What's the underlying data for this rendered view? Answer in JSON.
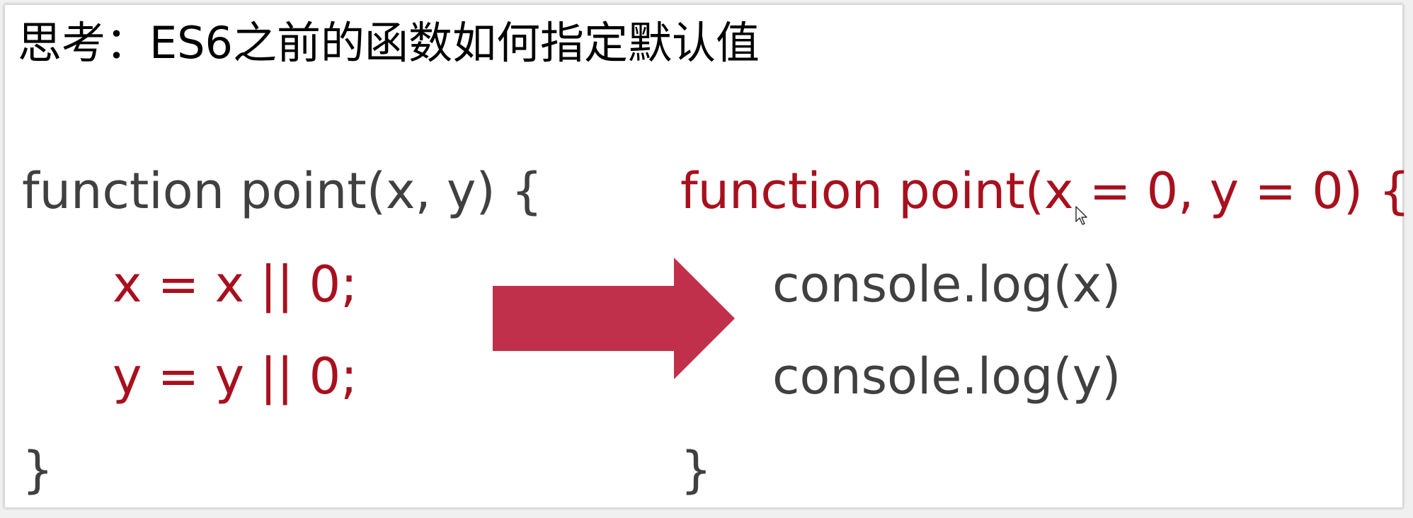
{
  "colors": {
    "text": "#404040",
    "accent": "#a8101e",
    "arrow": "#c0304a"
  },
  "slide": {
    "title": "思考：ES6之前的函数如何指定默认值",
    "left_code": [
      "function point(x, y) {",
      "x = x || 0;",
      "y = y || 0;",
      "}"
    ],
    "right_code": [
      "function point(x = 0, y = 0) {",
      "console.log(x)",
      "console.log(y)",
      "}"
    ],
    "arrow_icon": "right-arrow-icon",
    "cursor_icon": "mouse-pointer-icon"
  }
}
